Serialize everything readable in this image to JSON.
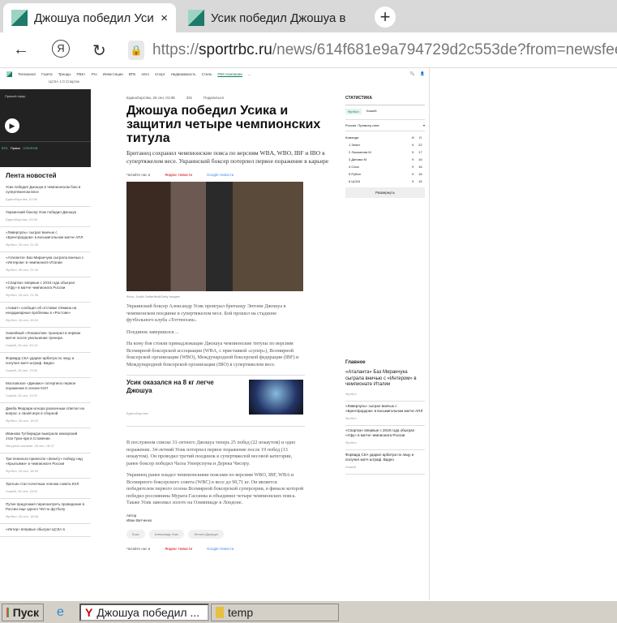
{
  "browser": {
    "tabs": [
      {
        "title": "Джошуа победил Усика",
        "close": "×"
      },
      {
        "title": "Усик победил Джошуа в"
      }
    ],
    "new_tab": "+",
    "back": "←",
    "yandex": "Я",
    "reload": "↻",
    "url_domain": "sportrbc.ru",
    "url_scheme": "https://",
    "url_path": "/news/614f681e9a794729d2c553de?from=newsfeed"
  },
  "site": {
    "nav": [
      "Телеканал",
      "Газета",
      "Тренды",
      "РБК+",
      "Pro",
      "Инвестиции",
      "ВТБ",
      "Авто",
      "Спорт",
      "Недвижимость",
      "Стиль",
      "РБК Компании",
      "..."
    ],
    "subnav": "ЦСКА 1:0 Спартак",
    "live": "Прямой эфир",
    "ticker": [
      "ВТБ",
      "Прямо",
      "USD/RUB"
    ],
    "feed_title": "Лента новостей",
    "feed": [
      {
        "t": "Усик победил Джошуа в чемпионском бою в супертяжелом весе",
        "m": "Единоборства, 01:08"
      },
      {
        "t": "Украинский боксер Усик победил Джошуа",
        "m": "Единоборства, 01:08"
      },
      {
        "t": "«Ливерпуль» сыграл вничью с «Брентфордом» в восьмигольном матче АПЛ",
        "m": "Футбол, 26 сен, 21:33"
      },
      {
        "t": "«Аталанта» Баз Миранчука сыграла вничью с «Интером» в чемпионате Италии",
        "m": "Футбол, 26 сен, 21:34"
      },
      {
        "t": "«Спартак» впервые с 2019 года обыграл «Уфу» в матче чемпионата России",
        "m": "Футбол, 26 сен, 21:28"
      },
      {
        "t": "«Ахмат» сообщил об отставке Сёмина на неординарные проблемы в «Ростове»",
        "m": "Футбол, 26 сен, 20:03"
      },
      {
        "t": "Хоккейный «Локомотив» проиграл в первом матче после увольнения тренера",
        "m": "Хоккей, 26 сен, 20:13"
      },
      {
        "t": "Форвард СКА ударил арбитра по лицу и получил матч-штраф. Видео",
        "m": "Хоккей, 26 сен, 19:32"
      },
      {
        "t": "Московское «Динамо» потерпело первое поражение в сезоне КХЛ",
        "m": "Хоккей, 26 сен, 19:22"
      },
      {
        "t": "Джеба Феррари игнора различным ответил на вопрос о своей игре в сборной",
        "m": "Футбол, 26 сен, 19:22"
      },
      {
        "t": "Иванова Тутберидзе выиграла юниорский этап Гран-при в Словении",
        "m": "Фигурное катание, 26 сен, 18:37"
      },
      {
        "t": "Три пенальти принесли «Зениту» победу над «Крыльями» в чемпионате России",
        "m": "Футбол, 26 сен, 18:33"
      },
      {
        "t": "Третьяк стал почетным членом совета КХЛ",
        "m": "Хоккей, 26 сен, 18:31"
      },
      {
        "t": "Путин предложил пересмотреть проведение в России еще одного ЧМ по футболу",
        "m": "Футбол, 26 сен, 18:08"
      },
      {
        "t": "«Интер» впервые обыграл ЦСКА в",
        "m": ""
      }
    ],
    "article": {
      "rubric": "Единоборства, 26 сен, 01:08",
      "views": "331",
      "share": "Поделиться",
      "title": "Джошуа победил Усика и защитил четыре чемпионских титула",
      "lead": "Британец сохранил чемпионские пояса по версиям WBA, WBO, IBF и IBO в супертяжелом весе. Украинский боксер потерпел первое поражение в карьере",
      "read_in": "Читайте нас в",
      "yandex": "Яндекс Новости",
      "google": "Google Новости",
      "photo_caption": "Фото: Justin Setterfield/Getty Images",
      "p1": "Украинский боксер Александр Усик проиграл британцу Энтони Джошуа в чемпионском поединке в супертяжелом весе. Бой прошел на стадионе футбольного клуба «Тоттенхэм».",
      "p2": "Поединок завершился ...",
      "p3": "На кону боя стояли принадлежащие Джошуа чемпионские титулы по версиям Всемирной боксерской ассоциации (WBA, с приставкой «супер»), Всемирной боксерской организации (WBO), Международной боксерской федерации (IBF) и Международной боксерской организации (IBO) в супертяжелом весе.",
      "related_title": "Усик оказался на 8 кг легче Джошуа",
      "related_src": "Единоборства",
      "p4": "В послужном списке 31-летнего Джошуа теперь 25 побед (22 нокаутом) и одно поражение. 34-летний Усик потерпел первое поражение после 19 побед (13 нокаутом). Он проводил третий поединок в супертяжелой весовой категории, ранее боксер победил Чазза Уизерспуна и Дерека Чисору.",
      "p5": "Украинец ранее владел чемпионскими поясами по версиям WBO, IBF, WBA и Всемирного боксерского совета (WBC) в весе до 90,71 кг. Он является победителем первого сезона Всемирной боксерской суперсерии, в финале которой победил россиянина Мурата Гассиева и объединил четыре чемпионских пояса. Также Усик завоевал золото на Олимпиаде в Лондоне.",
      "author_label": "Автор",
      "author": "Иван Витченко",
      "tags": [
        "Бокс",
        "Александр Усик",
        "Энтони Джошуа"
      ]
    },
    "stats": {
      "title": "СТАТИСТИКА",
      "tabs": [
        "Футбол",
        "Хоккей"
      ],
      "league": "Россия. Премьер-лига",
      "cols": [
        "Команда",
        "И",
        "О"
      ],
      "rows": [
        [
          "1 Зенит",
          "9",
          "22"
        ],
        [
          "2 Локомотив М",
          "9",
          "17"
        ],
        [
          "3 Динамо М",
          "9",
          "16"
        ],
        [
          "4 Сочи",
          "9",
          "16"
        ],
        [
          "5 Рубин",
          "9",
          "16"
        ],
        [
          "6 ЦСКА",
          "9",
          "15"
        ]
      ],
      "expand": "Развернуть"
    },
    "main": {
      "title": "Главное",
      "items": [
        {
          "t": "«Аталанта» Баз Миранчука сыграла вничью с «Интером» в чемпионате Италии",
          "m": "Футбол"
        },
        {
          "t": "«Ливерпуль» сыграл вничью с «Брентфордом» в восьмигольном матче АПЛ",
          "m": "Футбол"
        },
        {
          "t": "«Спартак» впервые с 2019 года обыграл «Уфу» в матче чемпионата России",
          "m": "Футбол"
        },
        {
          "t": "Форвард СКА ударил арбитра по лицу и получил матч-штраф. Видео",
          "m": "Хоккей"
        }
      ]
    }
  },
  "taskbar": {
    "start": "Пуск",
    "windows": [
      "Джошуа победил ...",
      "temp"
    ]
  }
}
